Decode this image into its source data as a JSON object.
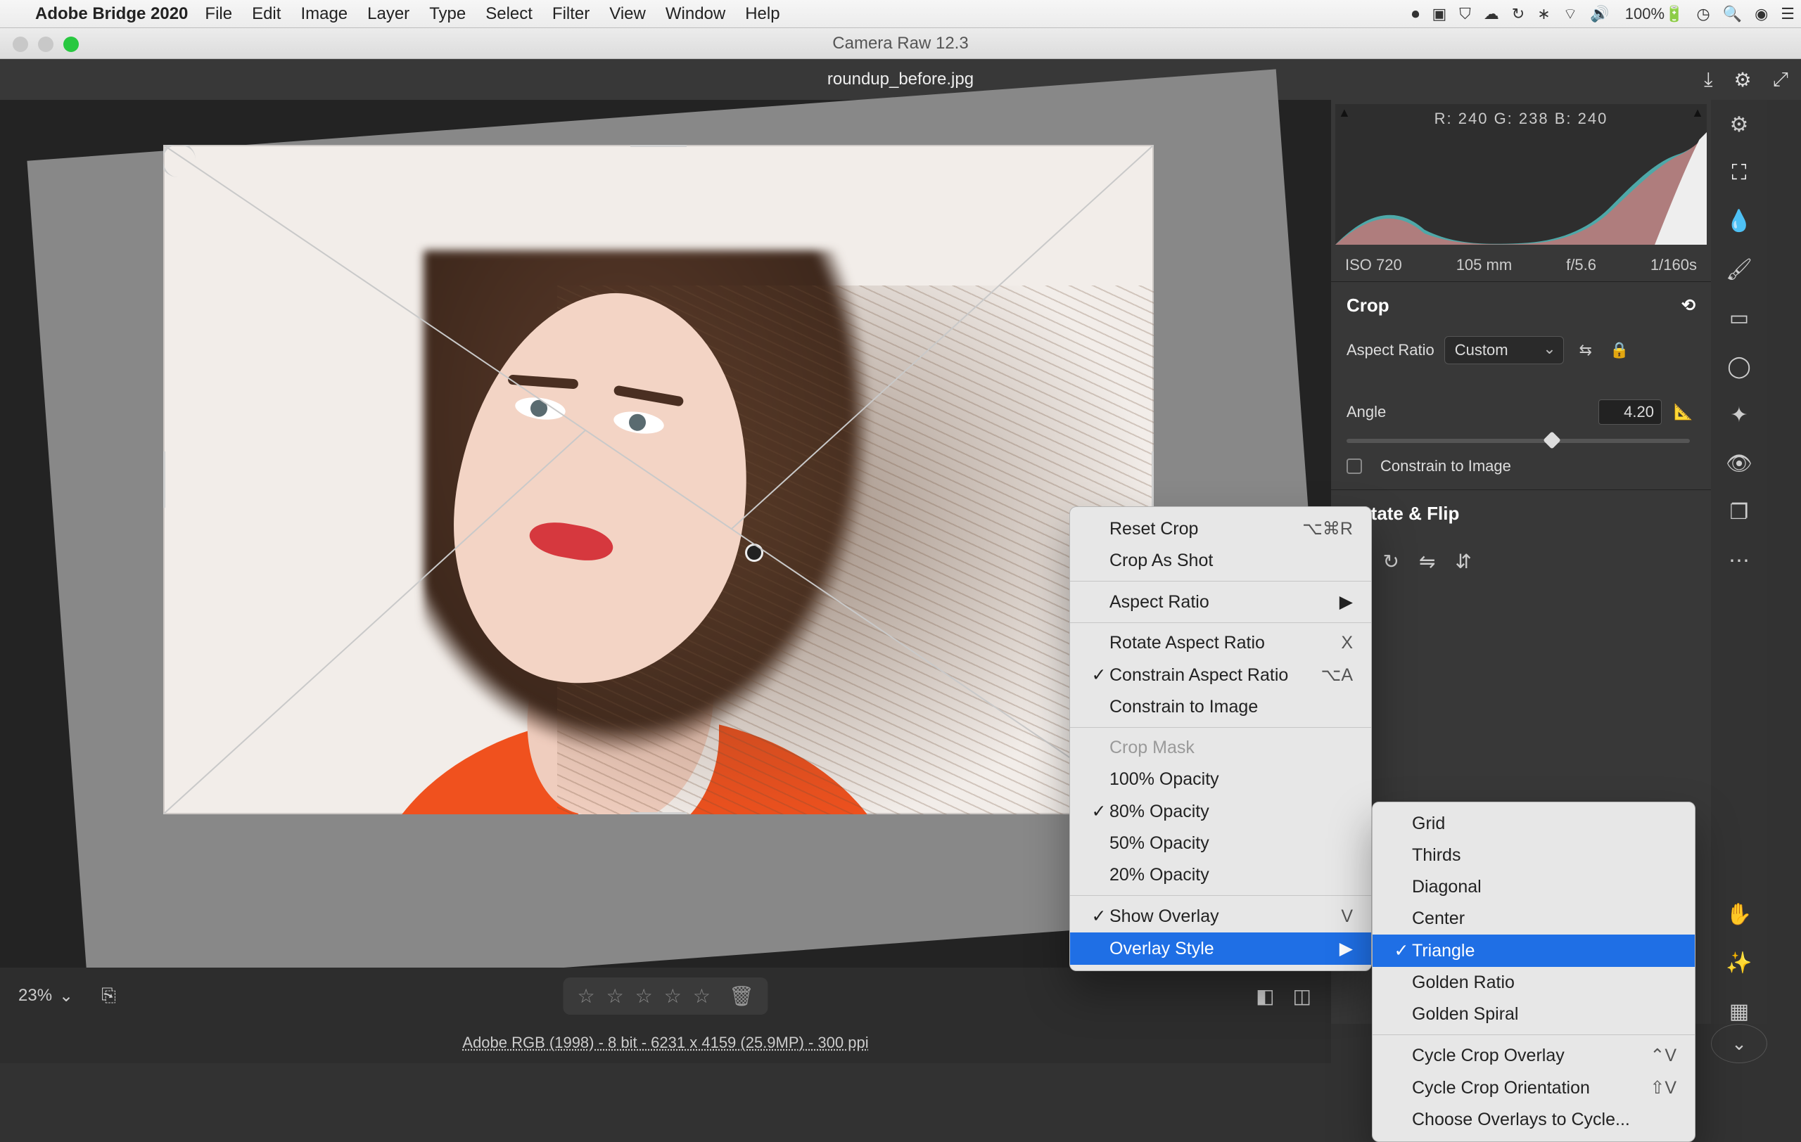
{
  "menubar": {
    "app": "Adobe Bridge 2020",
    "items": [
      "File",
      "Edit",
      "Image",
      "Layer",
      "Type",
      "Select",
      "Filter",
      "View",
      "Window",
      "Help"
    ],
    "battery": "100%"
  },
  "window": {
    "title": "Camera Raw 12.3"
  },
  "doc": {
    "filename": "roundup_before.jpg",
    "download_icon": "download-icon",
    "settings_icon": "gear-icon",
    "fullscreen_icon": "fullscreen-icon"
  },
  "histogram": {
    "readout": "R:  240   G: 238   B:  240"
  },
  "exif": {
    "iso": "ISO 720",
    "focal": "105 mm",
    "aperture": "f/5.6",
    "shutter": "1/160s"
  },
  "crop_panel": {
    "title": "Crop",
    "aspect_label": "Aspect Ratio",
    "aspect_value": "Custom",
    "angle_label": "Angle",
    "angle_value": "4.20",
    "constrain_label": "Constrain to Image",
    "rotflip_title": "Rotate & Flip"
  },
  "bottom": {
    "zoom": "23%",
    "infoline": "Adobe RGB (1998) - 8 bit - 6231 x 4159 (25.9MP) - 300 ppi"
  },
  "context_menu": {
    "items": [
      {
        "label": "Reset Crop",
        "shortcut": "⌥⌘R"
      },
      {
        "label": "Crop As Shot"
      },
      {
        "sep": true
      },
      {
        "label": "Aspect Ratio",
        "submenu": true
      },
      {
        "sep": true
      },
      {
        "label": "Rotate Aspect Ratio",
        "shortcut": "X"
      },
      {
        "label": "Constrain Aspect Ratio",
        "checked": true,
        "shortcut": "⌥A"
      },
      {
        "label": "Constrain to Image"
      },
      {
        "sep": true
      },
      {
        "label": "Crop Mask",
        "disabled": true
      },
      {
        "label": "100% Opacity"
      },
      {
        "label": "80% Opacity",
        "checked": true
      },
      {
        "label": "50% Opacity"
      },
      {
        "label": "20% Opacity"
      },
      {
        "sep": true
      },
      {
        "label": "Show Overlay",
        "checked": true,
        "shortcut": "V"
      },
      {
        "label": "Overlay Style",
        "submenu": true,
        "selected": true
      }
    ]
  },
  "overlay_submenu": {
    "items": [
      {
        "label": "Grid"
      },
      {
        "label": "Thirds"
      },
      {
        "label": "Diagonal"
      },
      {
        "label": "Center"
      },
      {
        "label": "Triangle",
        "checked": true,
        "selected": true
      },
      {
        "label": "Golden Ratio"
      },
      {
        "label": "Golden Spiral"
      },
      {
        "sep": true
      },
      {
        "label": "Cycle Crop Overlay",
        "shortcut": "⌃V"
      },
      {
        "label": "Cycle Crop Orientation",
        "shortcut": "⇧V"
      },
      {
        "label": "Choose Overlays to Cycle..."
      }
    ]
  },
  "vtoolbar": {
    "items": [
      "sliders",
      "crop",
      "eyedropper",
      "brush",
      "gradient",
      "radial",
      "spot",
      "redeye",
      "snapshot",
      "more"
    ],
    "bottom": [
      "hand",
      "magic",
      "grid"
    ]
  }
}
